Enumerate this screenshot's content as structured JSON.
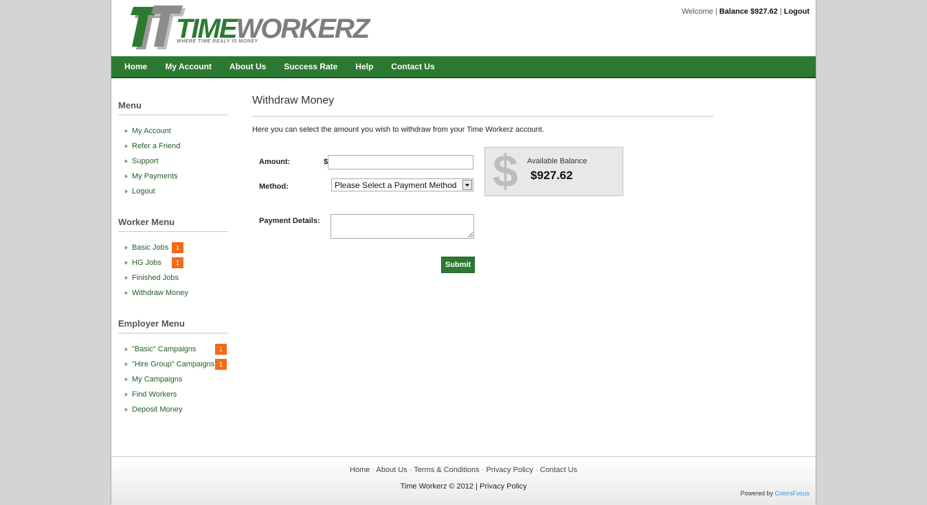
{
  "logo": {
    "word_part1": "TIME",
    "word_part2": "WORKERZ",
    "tagline": "WHERE TIME REALY IS MONEY"
  },
  "topbar": {
    "welcome": "Welcome",
    "balance": "Balance $927.62",
    "logout": "Logout"
  },
  "nav": [
    "Home",
    "My Account",
    "About Us",
    "Success Rate",
    "Help",
    "Contact Us"
  ],
  "sidebar": {
    "menu": {
      "title": "Menu",
      "items": [
        "My Account",
        "Refer a Friend",
        "Support",
        "My Payments",
        "Logout"
      ]
    },
    "worker": {
      "title": "Worker Menu",
      "items": [
        {
          "label": "Basic Jobs",
          "badge": "1"
        },
        {
          "label": "HG Jobs",
          "badge": "1"
        },
        {
          "label": "Finished Jobs"
        },
        {
          "label": "Withdraw Money"
        }
      ]
    },
    "employer": {
      "title": "Employer Menu",
      "items": [
        {
          "label": "\"Basic\" Campaigns",
          "badge": "1"
        },
        {
          "label": "\"Hire Group\" Campaigns",
          "badge": "1"
        },
        {
          "label": "My Campaigns"
        },
        {
          "label": "Find Workers"
        },
        {
          "label": "Deposit Money"
        }
      ]
    }
  },
  "main": {
    "title": "Withdraw Money",
    "intro": "Here you can select the amount you wish to withdraw from your Time Workerz account.",
    "form": {
      "amount_label": "Amount:",
      "currency": "$",
      "amount_value": "",
      "method_label": "Method:",
      "method_selected": "Please Select a Payment Method",
      "details_label": "Payment Details:",
      "submit_label": "Submit"
    },
    "balance": {
      "icon": "dollar-sign-icon",
      "label": "Available Balance",
      "amount": "$927.62"
    }
  },
  "footer": {
    "links": [
      "Home",
      "About Us",
      "Terms & Conditions",
      "Privacy Policy",
      "Contact Us"
    ],
    "copyright": "Time Workerz © 2012",
    "privacy": "Privacy Policy",
    "powered_by": "Powered by",
    "powered_by_brand": "ColorsFocus"
  },
  "colors": {
    "brand_green": "#2c7a32",
    "badge_orange": "#f26b1b",
    "link_blue": "#3a8fd0"
  }
}
